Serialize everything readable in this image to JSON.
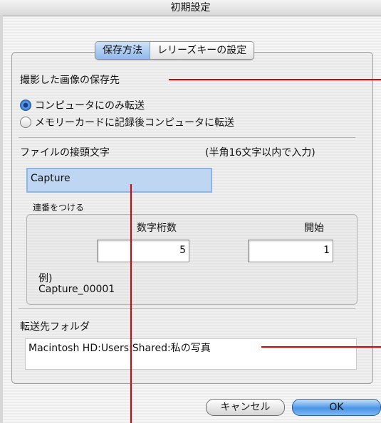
{
  "window": {
    "title": "初期設定"
  },
  "tabs": [
    {
      "label": "保存方法",
      "selected": true
    },
    {
      "label": "レリーズキーの設定",
      "selected": false
    }
  ],
  "save_destination": {
    "heading": "撮影した画像の保存先",
    "options": [
      {
        "label": "コンピュータにのみ転送",
        "selected": true
      },
      {
        "label": "メモリーカードに記録後コンピュータに転送",
        "selected": false
      }
    ]
  },
  "file_prefix": {
    "label": "ファイルの接頭文字",
    "hint": "(半角16文字以内で入力)",
    "value": "Capture"
  },
  "sequence": {
    "heading": "連番をつける",
    "digits_label": "数字桁数",
    "digits_value": "5",
    "start_label": "開始",
    "start_value": "1",
    "example_label": "例)",
    "example_value": "Capture_00001"
  },
  "destination_folder": {
    "label": "転送先フォルダ",
    "path": "Macintosh HD:Users:Shared:私の写真"
  },
  "buttons": {
    "cancel": "キャンセル",
    "ok": "OK"
  },
  "colors": {
    "callout": "#e00000",
    "accent": "#4b95e6"
  }
}
